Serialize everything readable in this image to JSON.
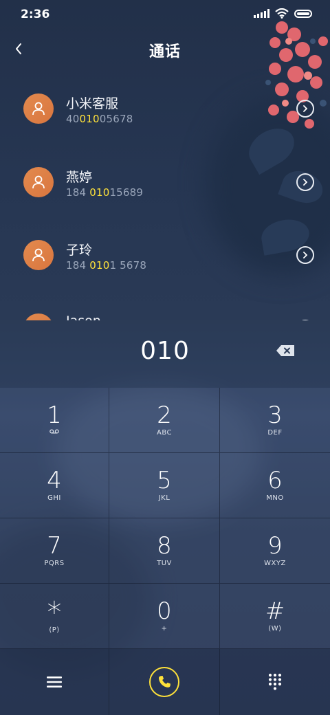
{
  "status_bar": {
    "time": "2:36"
  },
  "header": {
    "title": "通话"
  },
  "contacts": [
    {
      "name": "小米客服",
      "number_parts": [
        "40",
        "010",
        "05678"
      ]
    },
    {
      "name": "燕婷",
      "number_parts": [
        "184 ",
        "010",
        "15689"
      ]
    },
    {
      "name": "子玲",
      "number_parts": [
        "184 ",
        "010",
        "1 5678"
      ]
    },
    {
      "name": "Jason",
      "number_parts": [
        "",
        "",
        ""
      ]
    }
  ],
  "dial_input": {
    "value": "010"
  },
  "keypad": [
    {
      "digit": "1",
      "letters": ""
    },
    {
      "digit": "2",
      "letters": "ABC"
    },
    {
      "digit": "3",
      "letters": "DEF"
    },
    {
      "digit": "4",
      "letters": "GHI"
    },
    {
      "digit": "5",
      "letters": "JKL"
    },
    {
      "digit": "6",
      "letters": "MNO"
    },
    {
      "digit": "7",
      "letters": "PQRS"
    },
    {
      "digit": "8",
      "letters": "TUV"
    },
    {
      "digit": "9",
      "letters": "WXYZ"
    },
    {
      "digit": "*",
      "letters": "(P)"
    },
    {
      "digit": "0",
      "letters": "+"
    },
    {
      "digit": "#",
      "letters": "(W)"
    }
  ],
  "colors": {
    "highlight": "#ffe23a",
    "avatar": "#e0823f",
    "call_accent": "#ffe23a"
  },
  "icons": {
    "back": "chevron-left-icon",
    "detail": "chevron-right-circle-icon",
    "backspace": "backspace-icon",
    "voicemail": "voicemail-icon",
    "menu": "menu-icon",
    "call": "phone-icon",
    "dialpad": "dialpad-icon"
  }
}
